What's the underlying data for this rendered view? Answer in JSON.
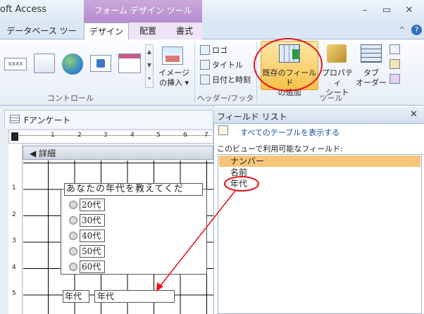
{
  "window": {
    "title": "oft Access",
    "context_tab": "フォーム デザイン ツール",
    "minimize": "–",
    "restore": "▭",
    "close": "✕"
  },
  "ribbon": {
    "tabs": [
      "データベース ツール",
      "デザイン",
      "配置",
      "書式"
    ],
    "active_tab": "デザイン",
    "help": "?",
    "collapse": "^",
    "groups": {
      "controls": {
        "label": "コントロール",
        "textbox_sample": "xxxx"
      },
      "header_footer": {
        "label": "ヘッダー/フッター",
        "logo": "ロゴ",
        "title": "タイトル",
        "datetime": "日付と時刻"
      },
      "image": {
        "label_line1": "イメージ",
        "label_line2": "の挿入 ▾"
      },
      "tools": {
        "label": "ツール",
        "add_existing_line1": "既存のフィールド",
        "add_existing_line2": "の追加",
        "property_line1": "プロパティ",
        "property_line2": "シート",
        "taborder_line1": "タブ",
        "taborder_line2": "オーダー"
      }
    },
    "accent_highlight": "#f7c14a",
    "annotation_color": "#e8141b"
  },
  "document": {
    "tab_label": "Fアンケート",
    "section_label": "詳細",
    "ruler_numbers": [
      "1",
      "2",
      "3",
      "4",
      "5",
      "6",
      "7"
    ],
    "left_ruler_numbers": [
      "1",
      "2",
      "3",
      "4",
      "5"
    ],
    "question_label": "あなたの年代を教えてくだ",
    "options": [
      "20代",
      "30代",
      "40代",
      "50代",
      "60代"
    ],
    "age_label": "年代",
    "age_textbox": "年代"
  },
  "field_list": {
    "title": "フィールド リスト",
    "close": "✕",
    "show_all": "すべてのテーブルを表示する",
    "available_label": "このビューで利用可能なフィールド:",
    "fields": [
      "ナンバー",
      "名前",
      "年代"
    ],
    "selected_field": "ナンバー"
  }
}
